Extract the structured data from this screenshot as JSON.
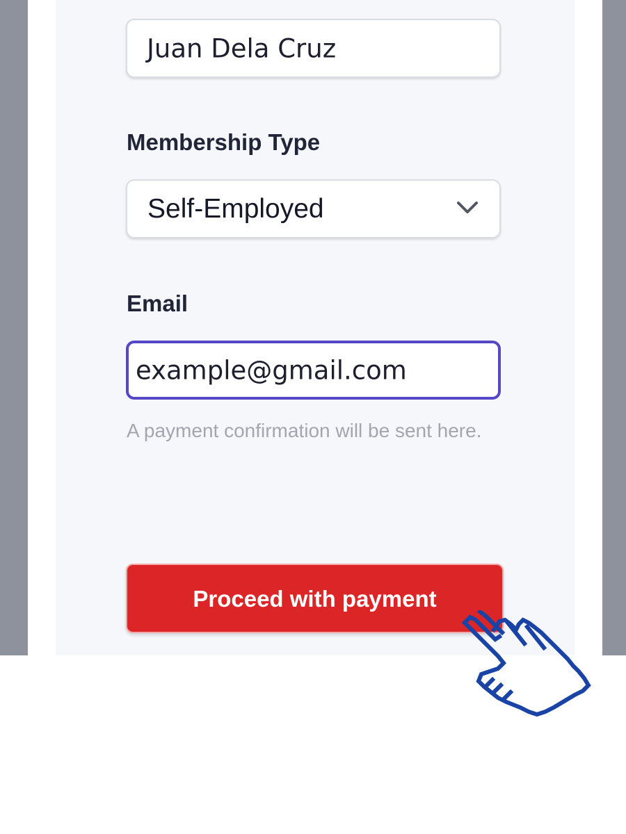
{
  "form": {
    "name_value": "Juan Dela Cruz",
    "membership_label": "Membership Type",
    "membership_value": "Self-Employed",
    "email_label": "Email",
    "email_value": "example@gmail.com",
    "email_helper": "A payment confirmation will be sent here.",
    "submit_label": "Proceed with payment"
  },
  "icons": {
    "select_icon": "chevron-down-icon",
    "cursor_icon": "pointing-hand-icon"
  },
  "colors": {
    "accent": "#5548c7",
    "button": "#dc2526",
    "cursor": "#1a43a6"
  }
}
